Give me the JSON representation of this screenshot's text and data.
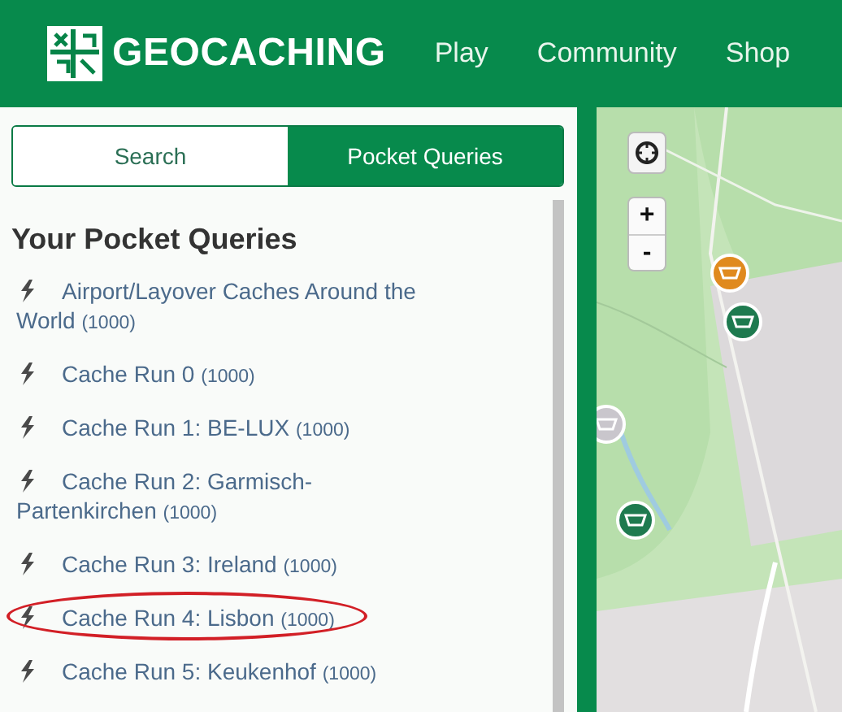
{
  "header": {
    "logo_text": "GEOCACHING",
    "nav": [
      "Play",
      "Community",
      "Shop"
    ]
  },
  "tabs": [
    {
      "label": "Search",
      "selected": false
    },
    {
      "label": "Pocket Queries",
      "selected": true
    }
  ],
  "panel_title": "Your Pocket Queries",
  "queries": [
    {
      "name": "Airport/Layover Caches Around the World",
      "count": "(1000)",
      "circled": false
    },
    {
      "name": "Cache Run 0",
      "count": "(1000)",
      "circled": false
    },
    {
      "name": "Cache Run 1: BE-LUX",
      "count": "(1000)",
      "circled": false
    },
    {
      "name": "Cache Run 2: Garmisch-Partenkirchen",
      "count": "(1000)",
      "circled": false
    },
    {
      "name": "Cache Run 3: Ireland",
      "count": "(1000)",
      "circled": false
    },
    {
      "name": "Cache Run 4: Lisbon",
      "count": "(1000)",
      "circled": true
    },
    {
      "name": "Cache Run 5: Keukenhof",
      "count": "(1000)",
      "circled": false
    }
  ],
  "map": {
    "zoom_in": "+",
    "zoom_out": "-",
    "markers": [
      {
        "color": "#e08a1e"
      },
      {
        "color": "#1e7a4f"
      },
      {
        "color": "#c9c6cc"
      },
      {
        "color": "#1e7a4f"
      }
    ]
  }
}
